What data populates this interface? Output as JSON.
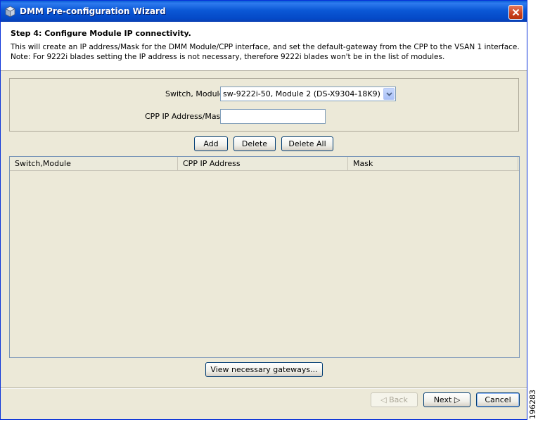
{
  "window": {
    "title": "DMM Pre-configuration Wizard"
  },
  "header": {
    "step_title": "Step 4: Configure Module IP connectivity.",
    "desc_line1": "This will create an IP address/Mask for the DMM Module/CPP interface,  and set the default-gateway from the CPP to the VSAN 1 interface.",
    "desc_line2": "Note: For 9222i blades setting the IP address is not necessary,  therefore 9222i blades won't be in the list of modules."
  },
  "form": {
    "switch_module_label": "Switch, Module",
    "switch_module_value": "sw-9222i-50, Module 2 (DS-X9304-18K9)",
    "cpp_ip_label": "CPP IP Address/Mask",
    "cpp_ip_value": ""
  },
  "actions": {
    "add": "Add",
    "delete": "Delete",
    "delete_all": "Delete All"
  },
  "table": {
    "columns": [
      "Switch,Module",
      "CPP IP Address",
      "Mask"
    ],
    "rows": []
  },
  "view_gateways_label": "View necessary gateways...",
  "footer": {
    "back": "◁ Back",
    "next": "Next ▷",
    "cancel": "Cancel"
  },
  "side_code": "196283",
  "icons": {
    "title": "cube-icon",
    "close": "close-icon",
    "combo": "chevron-down-icon"
  }
}
